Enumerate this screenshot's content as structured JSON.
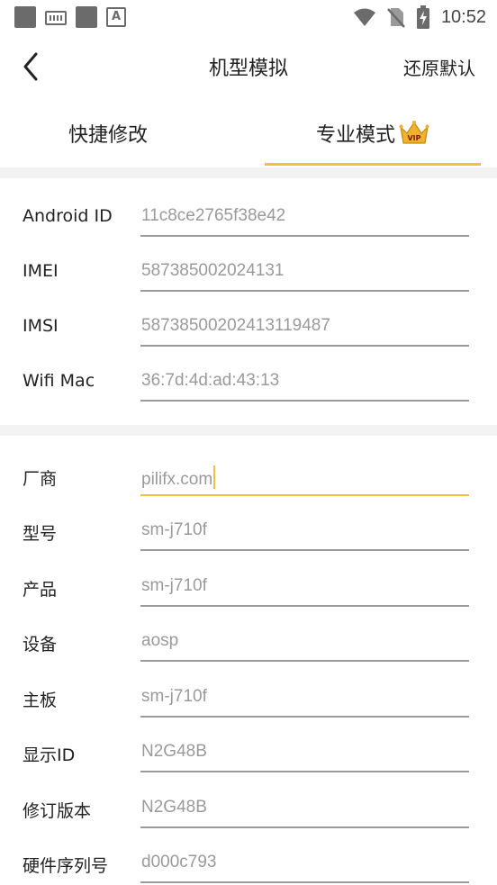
{
  "status_bar": {
    "time": "10:52"
  },
  "header": {
    "title": "机型模拟",
    "reset_label": "还原默认"
  },
  "tabs": [
    {
      "label": "快捷修改"
    },
    {
      "label": "专业模式",
      "badge": "VIP"
    }
  ],
  "section1": [
    {
      "label": "Android ID",
      "value": "11c8ce2765f38e42"
    },
    {
      "label": "IMEI",
      "value": "587385002024131"
    },
    {
      "label": "IMSI",
      "value": "58738500202413119487"
    },
    {
      "label": "Wifi Mac",
      "value": "36:7d:4d:ad:43:13"
    }
  ],
  "section2": [
    {
      "label": "厂商",
      "value": "pilifx.com"
    },
    {
      "label": "型号",
      "value": "sm-j710f"
    },
    {
      "label": "产品",
      "value": "sm-j710f"
    },
    {
      "label": "设备",
      "value": "aosp"
    },
    {
      "label": "主板",
      "value": "sm-j710f"
    },
    {
      "label": "显示ID",
      "value": "N2G48B"
    },
    {
      "label": "修订版本",
      "value": "N2G48B"
    },
    {
      "label": "硬件序列号",
      "value": "d000c793"
    }
  ],
  "colors": {
    "accent": "#f0c040",
    "text": "#222222",
    "value_text": "#9a9a9a",
    "divider": "#f3f3f3"
  },
  "icons": [
    "back-arrow-icon",
    "vip-crown-icon",
    "wifi-icon",
    "no-sim-icon",
    "battery-charging-icon"
  ]
}
